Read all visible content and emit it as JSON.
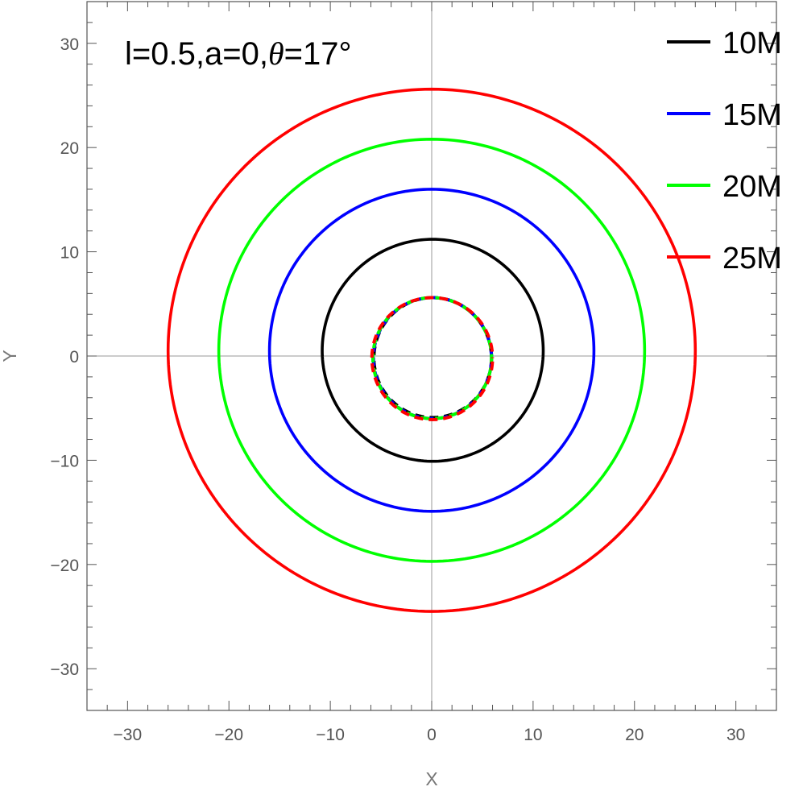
{
  "chart_data": {
    "type": "line",
    "xlabel": "X",
    "ylabel": "Y",
    "xlim": [
      -34,
      34
    ],
    "ylim": [
      -34,
      34
    ],
    "xticks": [
      -30,
      -20,
      -10,
      0,
      10,
      20,
      30
    ],
    "yticks": [
      -30,
      -20,
      -10,
      0,
      10,
      20,
      30
    ],
    "tick_labels": {
      "x": [
        "−30",
        "−20",
        "−10",
        "0",
        "10",
        "20",
        "30"
      ],
      "y": [
        "−30",
        "−20",
        "−10",
        "0",
        "10",
        "20",
        "30"
      ]
    },
    "annotation": {
      "prefix": "l=0.5,a=0,",
      "symbol": "θ",
      "suffix": "=17°"
    },
    "legend_position": "top-right",
    "grid": false,
    "zero_lines": true,
    "series": [
      {
        "name": "10M",
        "color": "#000000",
        "style": "solid",
        "points": [
          [
            11.0,
            0.5
          ],
          [
            0.0,
            11.2
          ],
          [
            -10.8,
            0.5
          ],
          [
            0.0,
            -10.1
          ]
        ]
      },
      {
        "name": "15M",
        "color": "#0000ff",
        "style": "solid",
        "points": [
          [
            16.0,
            0.5
          ],
          [
            0.0,
            16.0
          ],
          [
            -16.0,
            0.5
          ],
          [
            0.0,
            -14.9
          ]
        ]
      },
      {
        "name": "20M",
        "color": "#00ff00",
        "style": "solid",
        "points": [
          [
            21.0,
            0.5
          ],
          [
            0.0,
            20.8
          ],
          [
            -21.0,
            0.5
          ],
          [
            0.0,
            -19.7
          ]
        ]
      },
      {
        "name": "25M",
        "color": "#ff0000",
        "style": "solid",
        "points": [
          [
            26.0,
            0.5
          ],
          [
            0.0,
            25.6
          ],
          [
            -26.0,
            0.5
          ],
          [
            0.0,
            -24.5
          ]
        ]
      },
      {
        "name": "",
        "color": "#000000",
        "style": "dashed",
        "points": [
          [
            5.9,
            -0.2
          ],
          [
            0.0,
            5.6
          ],
          [
            -5.7,
            -0.2
          ],
          [
            0.0,
            -5.9
          ]
        ]
      },
      {
        "name": "",
        "color": "#0000ff",
        "style": "dashed",
        "points": [
          [
            5.9,
            -0.2
          ],
          [
            0.0,
            5.6
          ],
          [
            -5.75,
            -0.2
          ],
          [
            0.0,
            -6.0
          ]
        ]
      },
      {
        "name": "",
        "color": "#00ff00",
        "style": "dashed",
        "points": [
          [
            5.9,
            -0.2
          ],
          [
            0.0,
            5.6
          ],
          [
            -5.8,
            -0.2
          ],
          [
            0.0,
            -6.0
          ]
        ]
      },
      {
        "name": "",
        "color": "#ff0000",
        "style": "dashed",
        "points": [
          [
            6.0,
            -0.2
          ],
          [
            0.0,
            5.6
          ],
          [
            -5.9,
            -0.2
          ],
          [
            0.0,
            -6.1
          ]
        ]
      }
    ]
  }
}
